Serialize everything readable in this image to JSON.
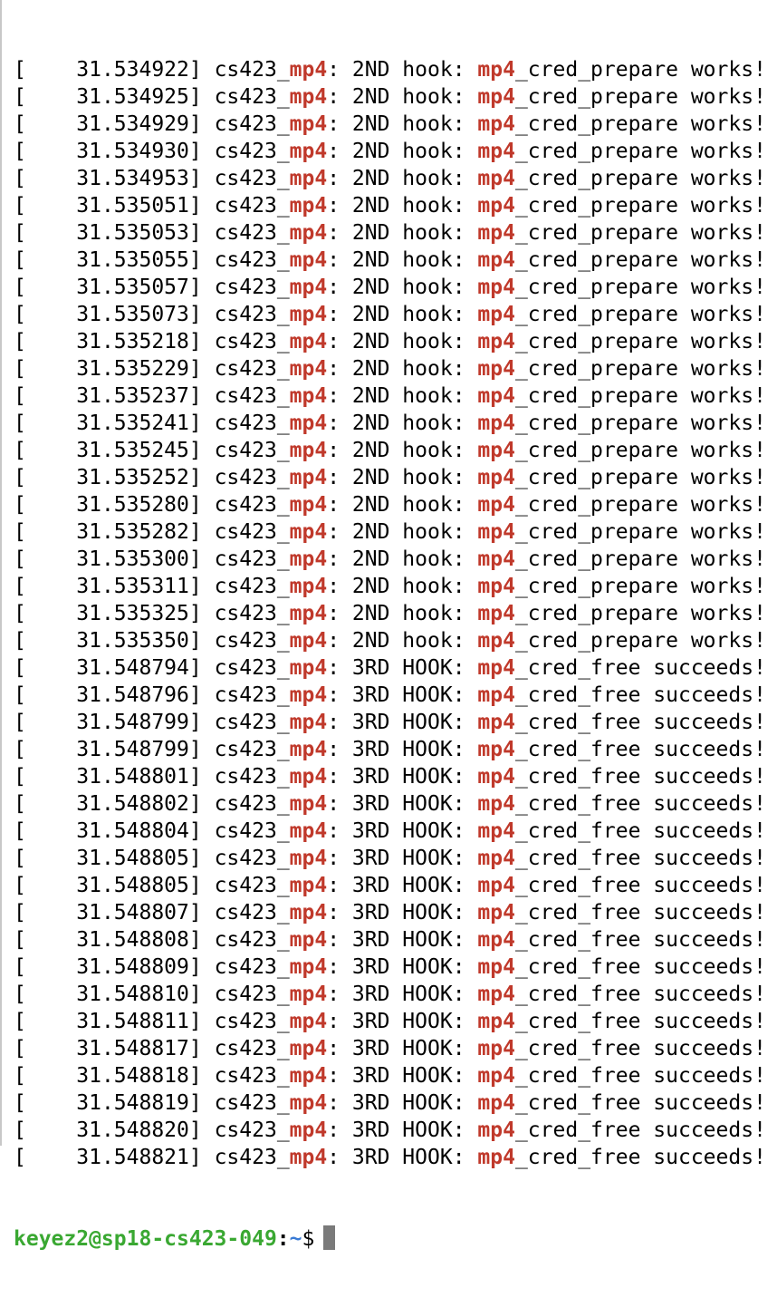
{
  "terminal": {
    "lines": [
      {
        "ts": "31.534922",
        "hook": "2ND hook:",
        "fn": "_cred_prepare",
        "result": "works!"
      },
      {
        "ts": "31.534925",
        "hook": "2ND hook:",
        "fn": "_cred_prepare",
        "result": "works!"
      },
      {
        "ts": "31.534929",
        "hook": "2ND hook:",
        "fn": "_cred_prepare",
        "result": "works!"
      },
      {
        "ts": "31.534930",
        "hook": "2ND hook:",
        "fn": "_cred_prepare",
        "result": "works!"
      },
      {
        "ts": "31.534953",
        "hook": "2ND hook:",
        "fn": "_cred_prepare",
        "result": "works!"
      },
      {
        "ts": "31.535051",
        "hook": "2ND hook:",
        "fn": "_cred_prepare",
        "result": "works!"
      },
      {
        "ts": "31.535053",
        "hook": "2ND hook:",
        "fn": "_cred_prepare",
        "result": "works!"
      },
      {
        "ts": "31.535055",
        "hook": "2ND hook:",
        "fn": "_cred_prepare",
        "result": "works!"
      },
      {
        "ts": "31.535057",
        "hook": "2ND hook:",
        "fn": "_cred_prepare",
        "result": "works!"
      },
      {
        "ts": "31.535073",
        "hook": "2ND hook:",
        "fn": "_cred_prepare",
        "result": "works!"
      },
      {
        "ts": "31.535218",
        "hook": "2ND hook:",
        "fn": "_cred_prepare",
        "result": "works!"
      },
      {
        "ts": "31.535229",
        "hook": "2ND hook:",
        "fn": "_cred_prepare",
        "result": "works!"
      },
      {
        "ts": "31.535237",
        "hook": "2ND hook:",
        "fn": "_cred_prepare",
        "result": "works!"
      },
      {
        "ts": "31.535241",
        "hook": "2ND hook:",
        "fn": "_cred_prepare",
        "result": "works!"
      },
      {
        "ts": "31.535245",
        "hook": "2ND hook:",
        "fn": "_cred_prepare",
        "result": "works!"
      },
      {
        "ts": "31.535252",
        "hook": "2ND hook:",
        "fn": "_cred_prepare",
        "result": "works!"
      },
      {
        "ts": "31.535280",
        "hook": "2ND hook:",
        "fn": "_cred_prepare",
        "result": "works!"
      },
      {
        "ts": "31.535282",
        "hook": "2ND hook:",
        "fn": "_cred_prepare",
        "result": "works!"
      },
      {
        "ts": "31.535300",
        "hook": "2ND hook:",
        "fn": "_cred_prepare",
        "result": "works!"
      },
      {
        "ts": "31.535311",
        "hook": "2ND hook:",
        "fn": "_cred_prepare",
        "result": "works!"
      },
      {
        "ts": "31.535325",
        "hook": "2ND hook:",
        "fn": "_cred_prepare",
        "result": "works!"
      },
      {
        "ts": "31.535350",
        "hook": "2ND hook:",
        "fn": "_cred_prepare",
        "result": "works!"
      },
      {
        "ts": "31.548794",
        "hook": "3RD HOOK:",
        "fn": "_cred_free",
        "result": "succeeds!"
      },
      {
        "ts": "31.548796",
        "hook": "3RD HOOK:",
        "fn": "_cred_free",
        "result": "succeeds!"
      },
      {
        "ts": "31.548799",
        "hook": "3RD HOOK:",
        "fn": "_cred_free",
        "result": "succeeds!"
      },
      {
        "ts": "31.548799",
        "hook": "3RD HOOK:",
        "fn": "_cred_free",
        "result": "succeeds!"
      },
      {
        "ts": "31.548801",
        "hook": "3RD HOOK:",
        "fn": "_cred_free",
        "result": "succeeds!"
      },
      {
        "ts": "31.548802",
        "hook": "3RD HOOK:",
        "fn": "_cred_free",
        "result": "succeeds!"
      },
      {
        "ts": "31.548804",
        "hook": "3RD HOOK:",
        "fn": "_cred_free",
        "result": "succeeds!"
      },
      {
        "ts": "31.548805",
        "hook": "3RD HOOK:",
        "fn": "_cred_free",
        "result": "succeeds!"
      },
      {
        "ts": "31.548805",
        "hook": "3RD HOOK:",
        "fn": "_cred_free",
        "result": "succeeds!"
      },
      {
        "ts": "31.548807",
        "hook": "3RD HOOK:",
        "fn": "_cred_free",
        "result": "succeeds!"
      },
      {
        "ts": "31.548808",
        "hook": "3RD HOOK:",
        "fn": "_cred_free",
        "result": "succeeds!"
      },
      {
        "ts": "31.548809",
        "hook": "3RD HOOK:",
        "fn": "_cred_free",
        "result": "succeeds!"
      },
      {
        "ts": "31.548810",
        "hook": "3RD HOOK:",
        "fn": "_cred_free",
        "result": "succeeds!"
      },
      {
        "ts": "31.548811",
        "hook": "3RD HOOK:",
        "fn": "_cred_free",
        "result": "succeeds!"
      },
      {
        "ts": "31.548817",
        "hook": "3RD HOOK:",
        "fn": "_cred_free",
        "result": "succeeds!"
      },
      {
        "ts": "31.548818",
        "hook": "3RD HOOK:",
        "fn": "_cred_free",
        "result": "succeeds!"
      },
      {
        "ts": "31.548819",
        "hook": "3RD HOOK:",
        "fn": "_cred_free",
        "result": "succeeds!"
      },
      {
        "ts": "31.548820",
        "hook": "3RD HOOK:",
        "fn": "_cred_free",
        "result": "succeeds!"
      },
      {
        "ts": "31.548821",
        "hook": "3RD HOOK:",
        "fn": "_cred_free",
        "result": "succeeds!"
      }
    ],
    "module_prefix": "cs423_",
    "module_name": "mp4",
    "fn_prefix": "mp4",
    "prompt": {
      "user_host": "keyez2@sp18-cs423-049",
      "separator": ":",
      "path": "~",
      "symbol": "$"
    },
    "colors": {
      "highlight": "#c0392b",
      "prompt_user": "#3aa832",
      "prompt_path": "#3a7bd5",
      "cursor": "#7a7a7a"
    }
  }
}
